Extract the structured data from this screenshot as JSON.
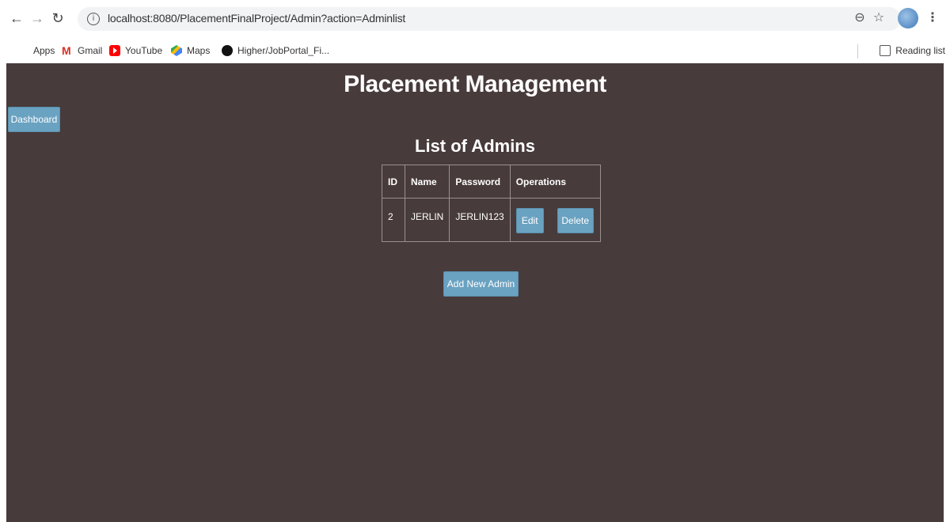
{
  "browser": {
    "url": "localhost:8080/PlacementFinalProject/Admin?action=Adminlist",
    "bookmarks": [
      "Apps",
      "Gmail",
      "YouTube",
      "Maps",
      "Higher/JobPortal_Fi..."
    ],
    "reading_list": "Reading list"
  },
  "page": {
    "title": "Placement Management",
    "dashboard_label": "Dashboard",
    "subtitle": "List of Admins",
    "table": {
      "headers": [
        "ID",
        "Name",
        "Password",
        "Operations"
      ],
      "rows": [
        {
          "id": "2",
          "name": "JERLIN",
          "password": "JERLIN123"
        }
      ],
      "edit_label": "Edit",
      "delete_label": "Delete"
    },
    "add_label": "Add New Admin"
  },
  "colors": {
    "page_bg": "#483b3b",
    "button": "#6aa2c1"
  }
}
